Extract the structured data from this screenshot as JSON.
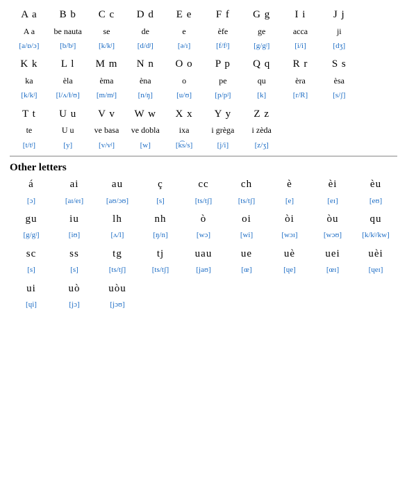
{
  "alphabet": {
    "rows": [
      {
        "letters": [
          {
            "main": "A a",
            "name": "A a",
            "ipa": "[a/ɒ/ɔ]"
          },
          {
            "main": "B b",
            "name": "be nauta",
            "ipa": "[b/bʲ]"
          },
          {
            "main": "C c",
            "name": "se",
            "ipa": "[k/kʲ]"
          },
          {
            "main": "D d",
            "name": "de",
            "ipa": "[d/dʲ]"
          },
          {
            "main": "E e",
            "name": "e",
            "ipa": "[ə/ɪ]"
          },
          {
            "main": "F f",
            "name": "èfe",
            "ipa": "[f/fʲ]"
          },
          {
            "main": "G g",
            "name": "ge",
            "ipa": "[g/gʲ]"
          },
          {
            "main": "I i",
            "name": "acca",
            "ipa": "[i/i]"
          },
          {
            "main": "J j",
            "name": "ji",
            "ipa": "[dʒ]"
          },
          {
            "main": "",
            "name": "",
            "ipa": ""
          }
        ]
      },
      {
        "letters": [
          {
            "main": "K k",
            "name": "ka",
            "ipa": "[k/kʲ]"
          },
          {
            "main": "L l",
            "name": "èla",
            "ipa": "[l/ʌ/ɫ/ʊ]"
          },
          {
            "main": "M m",
            "name": "èma",
            "ipa": "[m/mʲ]"
          },
          {
            "main": "N n",
            "name": "èna",
            "ipa": "[n/ŋ]"
          },
          {
            "main": "O o",
            "name": "o",
            "ipa": "[u/ʊ]"
          },
          {
            "main": "P p",
            "name": "pe",
            "ipa": "[p/pʲ]"
          },
          {
            "main": "Q q",
            "name": "qu",
            "ipa": "[k]"
          },
          {
            "main": "R r",
            "name": "èra",
            "ipa": "[r/R]"
          },
          {
            "main": "S s",
            "name": "èsa",
            "ipa": "[s/ʃ]"
          },
          {
            "main": "",
            "name": "",
            "ipa": ""
          }
        ]
      },
      {
        "letters": [
          {
            "main": "T t",
            "name": "te",
            "ipa": "[t/tʲ]"
          },
          {
            "main": "U u",
            "name": "U u",
            "ipa": "[y]"
          },
          {
            "main": "V v",
            "name": "ve basa",
            "ipa": "[v/vʲ]"
          },
          {
            "main": "W w",
            "name": "ve dobla",
            "ipa": "[w]"
          },
          {
            "main": "X x",
            "name": "ixa",
            "ipa": "[k͡s/s]"
          },
          {
            "main": "Y y",
            "name": "i grèga",
            "ipa": "[j/i]"
          },
          {
            "main": "Z z",
            "name": "i zèda",
            "ipa": "[z/ʒ]"
          },
          {
            "main": "",
            "name": "",
            "ipa": ""
          },
          {
            "main": "",
            "name": "",
            "ipa": ""
          },
          {
            "main": "",
            "name": "",
            "ipa": ""
          }
        ]
      }
    ]
  },
  "other": {
    "title": "Other letters",
    "rows": [
      {
        "letters": [
          {
            "main": "á",
            "name": "",
            "ipa": "[ɔ]"
          },
          {
            "main": "ai",
            "name": "",
            "ipa": "[aɪ/eɪ]"
          },
          {
            "main": "au",
            "name": "",
            "ipa": "[aʊ/ɔʊ]"
          },
          {
            "main": "ç",
            "name": "",
            "ipa": "[s]"
          },
          {
            "main": "cc",
            "name": "",
            "ipa": "[ts/tʃ]"
          },
          {
            "main": "ch",
            "name": "",
            "ipa": "[ts/tʃ]"
          },
          {
            "main": "è",
            "name": "",
            "ipa": "[e]"
          },
          {
            "main": "èi",
            "name": "",
            "ipa": "[eɪ]"
          },
          {
            "main": "èu",
            "name": "",
            "ipa": "[eʊ]"
          }
        ]
      },
      {
        "letters": [
          {
            "main": "gu",
            "name": "",
            "ipa": "[g/gʲ]"
          },
          {
            "main": "iu",
            "name": "",
            "ipa": "[iʊ]"
          },
          {
            "main": "lh",
            "name": "",
            "ipa": "[ʌ/l]"
          },
          {
            "main": "nh",
            "name": "",
            "ipa": "[ŋ/n]"
          },
          {
            "main": "ò",
            "name": "",
            "ipa": "[wɔ]"
          },
          {
            "main": "oi",
            "name": "",
            "ipa": "[wi]"
          },
          {
            "main": "òi",
            "name": "",
            "ipa": "[wɔɪ]"
          },
          {
            "main": "òu",
            "name": "",
            "ipa": "[wɔʊ]"
          },
          {
            "main": "qu",
            "name": "",
            "ipa": "[k/kʲ/kw]"
          }
        ]
      },
      {
        "letters": [
          {
            "main": "sc",
            "name": "",
            "ipa": "[s]"
          },
          {
            "main": "ss",
            "name": "",
            "ipa": "[s]"
          },
          {
            "main": "tg",
            "name": "",
            "ipa": "[ts/tʃ]"
          },
          {
            "main": "tj",
            "name": "",
            "ipa": "[ts/tʃ]"
          },
          {
            "main": "uau",
            "name": "",
            "ipa": "[jaʊ]"
          },
          {
            "main": "ue",
            "name": "",
            "ipa": "[œ]"
          },
          {
            "main": "uè",
            "name": "",
            "ipa": "[ɥe]"
          },
          {
            "main": "uei",
            "name": "",
            "ipa": "[œɪ]"
          },
          {
            "main": "uèi",
            "name": "",
            "ipa": "[ɥeɪ]"
          }
        ]
      },
      {
        "letters": [
          {
            "main": "ui",
            "name": "",
            "ipa": "[ɥi]"
          },
          {
            "main": "uò",
            "name": "",
            "ipa": "[jɔ]"
          },
          {
            "main": "uòu",
            "name": "",
            "ipa": "[jɔʊ]"
          },
          {
            "main": "",
            "name": "",
            "ipa": ""
          },
          {
            "main": "",
            "name": "",
            "ipa": ""
          },
          {
            "main": "",
            "name": "",
            "ipa": ""
          },
          {
            "main": "",
            "name": "",
            "ipa": ""
          },
          {
            "main": "",
            "name": "",
            "ipa": ""
          },
          {
            "main": "",
            "name": "",
            "ipa": ""
          }
        ]
      }
    ]
  }
}
